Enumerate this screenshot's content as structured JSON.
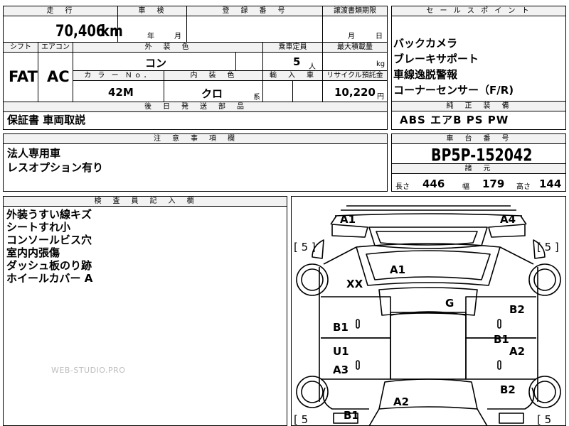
{
  "top_sheet": {
    "labels": {
      "mileage": "走　行",
      "inspection": "車　検",
      "registration": "登　録　番　号",
      "transfer_deadline": "譲渡書類期限",
      "shift": "シフト",
      "aircon": "エアコン",
      "exterior_color": "外　装　色",
      "capacity": "乗車定員",
      "max_load": "最大積載量",
      "color_no": "カ ラ ー Ｎｏ．",
      "interior_color": "内　装　色",
      "import": "輸　入　車",
      "recycle": "リサイクル預託金",
      "after_ship": "後　日　発　送　部　品",
      "caution": "注　意　事　項　欄",
      "selling_points": "セ ー ル ス ポ イ ン ト",
      "genuine": "純　正　装　備",
      "chassis_no": "車　台　番　号",
      "dimensions": "諸　元",
      "inspector_notes": "検　査　員　記　入　欄"
    },
    "mileage_value": "70,406",
    "mileage_unit": "km",
    "inspection_year": "年",
    "inspection_month": "月",
    "transfer_month": "月",
    "transfer_day": "日",
    "shift_value": "FAT",
    "aircon_value": "AC",
    "exterior_color_value": "コン",
    "capacity_value": "5",
    "capacity_unit": "人",
    "max_load_unit": "kg",
    "color_no_value": "42M",
    "interior_color_value": "クロ",
    "interior_suffix": "系",
    "recycle_value": "10,220",
    "recycle_unit": "円",
    "after_ship_value": "保証書 車両取説",
    "caution_lines": [
      "法人専用車",
      "レスオプション有り"
    ],
    "selling_points": [
      "バックカメラ",
      "ブレーキサポート",
      "車線逸脱警報",
      "コーナーセンサー（F/R)"
    ],
    "genuine_value": "ABS エアB PS PW",
    "chassis_value": "BP5P-152042",
    "dims": {
      "length_label": "長さ",
      "length": "446",
      "width_label": "幅",
      "width": "179",
      "height_label": "高さ",
      "height": "144"
    },
    "inspector_notes": [
      "外装うすい線キズ",
      "シートすれ小",
      "コンソールビス穴",
      "室内内張傷",
      "ダッシュ板のり跡",
      "ホイールカバー A"
    ],
    "watermark": "WEB-STUDIO.PRO"
  },
  "diagram_marks": {
    "a1_left": "A1",
    "a4_right": "A4",
    "a1_roof": "A1",
    "xx": "XX",
    "g": "G",
    "b1_left_door": "B1",
    "b2_right_front": "B2",
    "b1_right": "B1",
    "u1": "U1",
    "a2_right": "A2",
    "a3": "A3",
    "b2_right_rear": "B2",
    "a2_rear": "A2",
    "b1_rear_left": "B1",
    "tire_fl": "[ 5 ]",
    "tire_fr": "[ 5 ]",
    "tire_rl": "[ 5",
    "tire_rr": "[ 5"
  }
}
